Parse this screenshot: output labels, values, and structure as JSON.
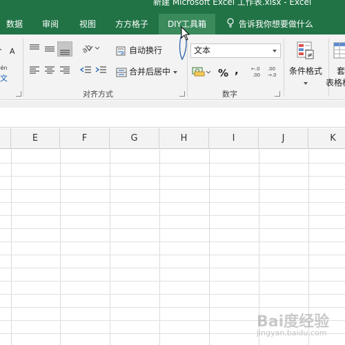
{
  "window": {
    "title": "新建 Microsoft Excel 工作表.xlsx  -  Excel"
  },
  "tabs": [
    {
      "label": "数据"
    },
    {
      "label": "审阅"
    },
    {
      "label": "视图"
    },
    {
      "label": "方方格子"
    },
    {
      "label": "DIY工具箱",
      "active": true
    },
    {
      "label": "告诉我你想要做什么"
    }
  ],
  "ribbon": {
    "partial_font_a": "A",
    "partial_font_wen_top": "wén",
    "partial_font_wen": "文",
    "wrap_text": "自动换行",
    "merge_center": "合并后居中",
    "alignment_group": "对齐方式",
    "number_format": "文本",
    "percent": "%",
    "comma": ",",
    "number_group": "数字",
    "conditional_format": "条件格式",
    "format_table_partial_1": "套",
    "format_table_partial_2": "表格格"
  },
  "columns": [
    "E",
    "F",
    "G",
    "H",
    "I",
    "J",
    "K"
  ],
  "watermark": {
    "text": "Bai度经验",
    "sub": "jingyan.baidu.com"
  },
  "colors": {
    "excel_green": "#217346",
    "active_tab": "#3b8a5c"
  }
}
